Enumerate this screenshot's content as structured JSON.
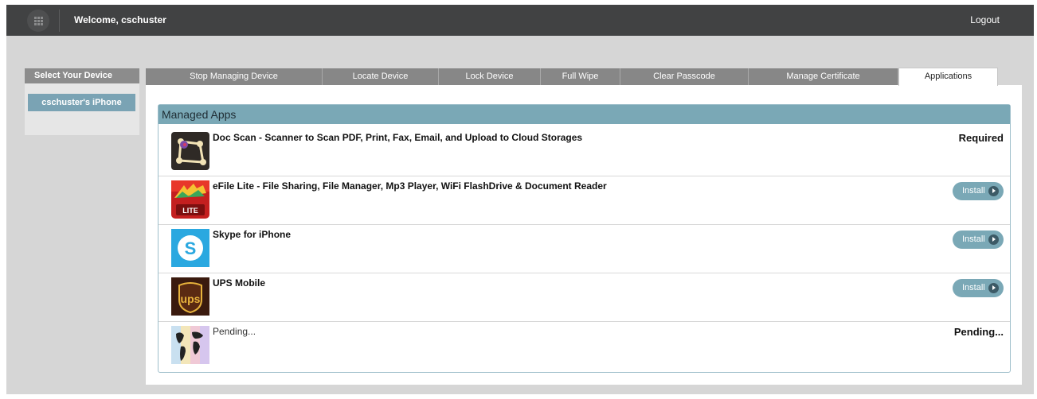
{
  "header": {
    "welcome": "Welcome, cschuster",
    "logout": "Logout"
  },
  "device_panel": {
    "title": "Select Your Device",
    "selected_device": "cschuster's iPhone"
  },
  "tabs": [
    {
      "label": "Stop Managing Device",
      "active": false
    },
    {
      "label": "Locate Device",
      "active": false
    },
    {
      "label": "Lock Device",
      "active": false
    },
    {
      "label": "Full Wipe",
      "active": false
    },
    {
      "label": "Clear Passcode",
      "active": false
    },
    {
      "label": "Manage Certificate",
      "active": false
    },
    {
      "label": "Applications",
      "active": true
    }
  ],
  "managed_apps": {
    "title": "Managed Apps",
    "apps": [
      {
        "name": "Doc Scan - Scanner to Scan PDF, Print, Fax, Email, and Upload to Cloud Storages",
        "status": "Required",
        "icon": "doc-scan-icon"
      },
      {
        "name": "eFile Lite - File Sharing, File Manager, Mp3 Player, WiFi FlashDrive & Document Reader",
        "action": "Install",
        "icon": "efile-lite-icon",
        "icon_badge": "LITE"
      },
      {
        "name": "Skype for iPhone",
        "action": "Install",
        "icon": "skype-icon",
        "icon_badge": "S"
      },
      {
        "name": "UPS Mobile",
        "action": "Install",
        "icon": "ups-icon",
        "icon_badge": "ups"
      },
      {
        "name": "Pending...",
        "status": "Pending...",
        "icon": "world-map-icon"
      }
    ]
  },
  "colors": {
    "topbar": "#414243",
    "accent": "#7aa8b6",
    "tab_inactive": "#878787",
    "background": "#d6d6d6"
  }
}
